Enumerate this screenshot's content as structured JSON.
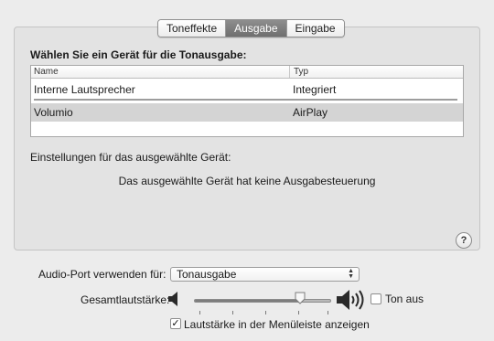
{
  "tabs": [
    {
      "label": "Toneffekte",
      "active": false
    },
    {
      "label": "Ausgabe",
      "active": true
    },
    {
      "label": "Eingabe",
      "active": false
    }
  ],
  "panel": {
    "heading": "Wählen Sie ein Gerät für die Tonausgabe:",
    "table": {
      "columns": [
        "Name",
        "Typ"
      ],
      "rows": [
        {
          "name": "Interne Lautsprecher",
          "type": "Integriert",
          "selected": false
        },
        {
          "name": "Volumio",
          "type": "AirPlay",
          "selected": true
        }
      ]
    },
    "settings_label": "Einstellungen für das ausgewählte Gerät:",
    "no_control_message": "Das ausgewählte Gerät hat keine Ausgabesteuerung",
    "help_label": "?"
  },
  "audio_port": {
    "label": "Audio-Port verwenden für:",
    "selected": "Tonausgabe"
  },
  "volume": {
    "label": "Gesamtlautstärke:",
    "level_fraction": 0.77,
    "low_icon": "speaker-low-icon",
    "high_icon": "speaker-high-icon"
  },
  "mute": {
    "label": "Ton aus",
    "checked": false
  },
  "menubar_option": {
    "label": "Lautstärke in der Menüleiste anzeigen",
    "checked": true
  },
  "colors": {
    "accent_tab": "#7c7c7c",
    "selection": "#d4d4d4",
    "panel_bg": "#e3e3e3"
  }
}
